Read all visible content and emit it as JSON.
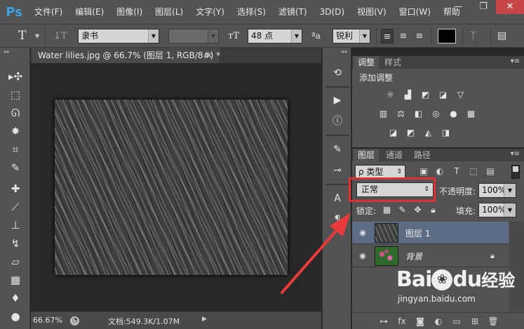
{
  "app": {
    "logo": "Ps"
  },
  "menu": [
    "文件(F)",
    "编辑(E)",
    "图像(I)",
    "图层(L)",
    "文字(Y)",
    "选择(S)",
    "滤镜(T)",
    "3D(D)",
    "视图(V)",
    "窗口(W)",
    "帮助"
  ],
  "window_controls": {
    "minimize": "—",
    "restore": "❐",
    "close": "✕"
  },
  "options_bar": {
    "tool_glyph": "T",
    "orient_glyph": "↨T",
    "font_family": "隶书",
    "font_style": "-",
    "size_glyph": "ᴛT",
    "font_size": "48 点",
    "aa_glyph": "ªa",
    "antialias": "锐利",
    "align": [
      "≡",
      "≡",
      "≡"
    ],
    "color": "#000000"
  },
  "document": {
    "tab_title": "Water lilies.jpg @ 66.7% (图层 1, RGB/8#) *",
    "tab_close": "×",
    "zoom": "66.67%",
    "doc_info": "文档:549.3K/1.07M",
    "more_arrow": "▶"
  },
  "adjustments_panel": {
    "tabs": [
      "调整",
      "样式"
    ],
    "title": "添加调整",
    "row1": [
      "☼",
      "▟",
      "◩",
      "◪",
      "▽"
    ],
    "row2": [
      "▥",
      "⚖",
      "◧",
      "◎",
      "●",
      "▦"
    ],
    "row3": [
      "◪",
      "◩",
      "◭",
      "◨"
    ]
  },
  "layers_panel": {
    "tabs": [
      "图层",
      "通道",
      "路径"
    ],
    "filter_label": "ρ 类型",
    "blend_mode": "正常",
    "opacity_label": "不透明度:",
    "opacity_value": "100%",
    "lock_label": "锁定:",
    "fill_label": "填充:",
    "fill_value": "100%",
    "layers": [
      {
        "name": "图层 1",
        "thumb": "rain",
        "selected": true
      },
      {
        "name": "背景",
        "thumb": "flowers",
        "selected": false,
        "locked": true
      }
    ]
  },
  "annotation": {
    "box_color": "#e03030",
    "arrow_color": "#e83a3a"
  },
  "watermark": {
    "brand": "Bai",
    "paw": "❀",
    "brand2": "du",
    "jingyan": "经验",
    "url": "jingyan.baidu.com"
  }
}
